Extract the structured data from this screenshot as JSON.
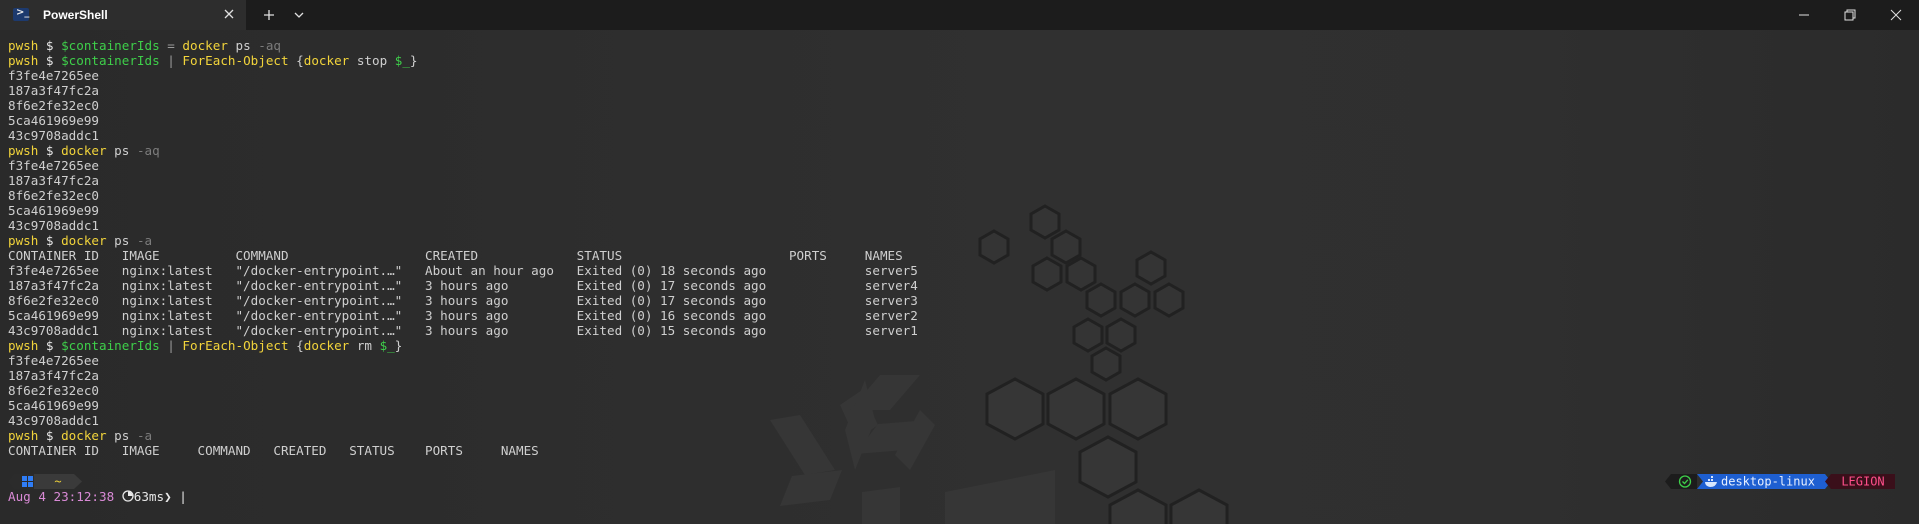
{
  "tab": {
    "title": "PowerShell"
  },
  "lines": [
    [
      {
        "t": "pwsh",
        "c": "c-pwsh"
      },
      {
        "t": " $ ",
        "c": "c-dollar"
      },
      {
        "t": "$containerIds",
        "c": "c-var"
      },
      {
        "t": " = ",
        "c": "c-op"
      },
      {
        "t": "docker",
        "c": "c-cmd"
      },
      {
        "t": " ps ",
        "c": "c-text"
      },
      {
        "t": "-aq",
        "c": "c-flag"
      }
    ],
    [
      {
        "t": "pwsh",
        "c": "c-pwsh"
      },
      {
        "t": " $ ",
        "c": "c-dollar"
      },
      {
        "t": "$containerIds",
        "c": "c-var"
      },
      {
        "t": " | ",
        "c": "c-op"
      },
      {
        "t": "ForEach-Object",
        "c": "c-cmd"
      },
      {
        "t": " {",
        "c": "c-text"
      },
      {
        "t": "docker",
        "c": "c-cmd"
      },
      {
        "t": " stop ",
        "c": "c-text"
      },
      {
        "t": "$_",
        "c": "c-var"
      },
      {
        "t": "}",
        "c": "c-text"
      }
    ],
    [
      {
        "t": "f3fe4e7265ee",
        "c": "c-text"
      }
    ],
    [
      {
        "t": "187a3f47fc2a",
        "c": "c-text"
      }
    ],
    [
      {
        "t": "8f6e2fe32ec0",
        "c": "c-text"
      }
    ],
    [
      {
        "t": "5ca461969e99",
        "c": "c-text"
      }
    ],
    [
      {
        "t": "43c9708addc1",
        "c": "c-text"
      }
    ],
    [
      {
        "t": "pwsh",
        "c": "c-pwsh"
      },
      {
        "t": " $ ",
        "c": "c-dollar"
      },
      {
        "t": "docker",
        "c": "c-cmd"
      },
      {
        "t": " ps ",
        "c": "c-text"
      },
      {
        "t": "-aq",
        "c": "c-flag"
      }
    ],
    [
      {
        "t": "f3fe4e7265ee",
        "c": "c-text"
      }
    ],
    [
      {
        "t": "187a3f47fc2a",
        "c": "c-text"
      }
    ],
    [
      {
        "t": "8f6e2fe32ec0",
        "c": "c-text"
      }
    ],
    [
      {
        "t": "5ca461969e99",
        "c": "c-text"
      }
    ],
    [
      {
        "t": "43c9708addc1",
        "c": "c-text"
      }
    ],
    [
      {
        "t": "pwsh",
        "c": "c-pwsh"
      },
      {
        "t": " $ ",
        "c": "c-dollar"
      },
      {
        "t": "docker",
        "c": "c-cmd"
      },
      {
        "t": " ps ",
        "c": "c-text"
      },
      {
        "t": "-a",
        "c": "c-flag"
      }
    ],
    [
      {
        "t": "CONTAINER ID   IMAGE          COMMAND                  CREATED             STATUS                      PORTS     NAMES",
        "c": "c-text"
      }
    ],
    [
      {
        "t": "f3fe4e7265ee   nginx:latest   \"/docker-entrypoint.…\"   About an hour ago   Exited (0) 18 seconds ago             server5",
        "c": "c-text"
      }
    ],
    [
      {
        "t": "187a3f47fc2a   nginx:latest   \"/docker-entrypoint.…\"   3 hours ago         Exited (0) 17 seconds ago             server4",
        "c": "c-text"
      }
    ],
    [
      {
        "t": "8f6e2fe32ec0   nginx:latest   \"/docker-entrypoint.…\"   3 hours ago         Exited (0) 17 seconds ago             server3",
        "c": "c-text"
      }
    ],
    [
      {
        "t": "5ca461969e99   nginx:latest   \"/docker-entrypoint.…\"   3 hours ago         Exited (0) 16 seconds ago             server2",
        "c": "c-text"
      }
    ],
    [
      {
        "t": "43c9708addc1   nginx:latest   \"/docker-entrypoint.…\"   3 hours ago         Exited (0) 15 seconds ago             server1",
        "c": "c-text"
      }
    ],
    [
      {
        "t": "pwsh",
        "c": "c-pwsh"
      },
      {
        "t": " $ ",
        "c": "c-dollar"
      },
      {
        "t": "$containerIds",
        "c": "c-var"
      },
      {
        "t": " | ",
        "c": "c-op"
      },
      {
        "t": "ForEach-Object",
        "c": "c-cmd"
      },
      {
        "t": " {",
        "c": "c-text"
      },
      {
        "t": "docker",
        "c": "c-cmd"
      },
      {
        "t": " rm ",
        "c": "c-text"
      },
      {
        "t": "$_",
        "c": "c-var"
      },
      {
        "t": "}",
        "c": "c-text"
      }
    ],
    [
      {
        "t": "f3fe4e7265ee",
        "c": "c-text"
      }
    ],
    [
      {
        "t": "187a3f47fc2a",
        "c": "c-text"
      }
    ],
    [
      {
        "t": "8f6e2fe32ec0",
        "c": "c-text"
      }
    ],
    [
      {
        "t": "5ca461969e99",
        "c": "c-text"
      }
    ],
    [
      {
        "t": "43c9708addc1",
        "c": "c-text"
      }
    ],
    [
      {
        "t": "pwsh",
        "c": "c-pwsh"
      },
      {
        "t": " $ ",
        "c": "c-dollar"
      },
      {
        "t": "docker",
        "c": "c-cmd"
      },
      {
        "t": " ps ",
        "c": "c-text"
      },
      {
        "t": "-a",
        "c": "c-flag"
      }
    ],
    [
      {
        "t": "CONTAINER ID   IMAGE     COMMAND   CREATED   STATUS    PORTS     NAMES",
        "c": "c-text"
      }
    ]
  ],
  "prompt": {
    "os_icon": "windows-icon",
    "path": "~",
    "datetime": "Aug 4 23:12:38",
    "duration": "63ms",
    "context": "desktop-linux",
    "user": "LEGION",
    "status_icon": "check-circle-icon",
    "context_icon": "docker-icon",
    "timer_icon": "stopwatch-icon"
  },
  "colors": {
    "pwsh": "#f2d43b",
    "variable": "#3ecf4a",
    "command": "#f2d43b",
    "flag": "#7c7c7c",
    "text": "#cfcfcf",
    "datetime": "#d98ad6",
    "context_bg": "#1e5fd1",
    "user_bg": "#3a0f1a",
    "user_fg": "#ff4f8b",
    "os_bg": "#2b2b2b",
    "path_bg": "#3a3a3a"
  }
}
